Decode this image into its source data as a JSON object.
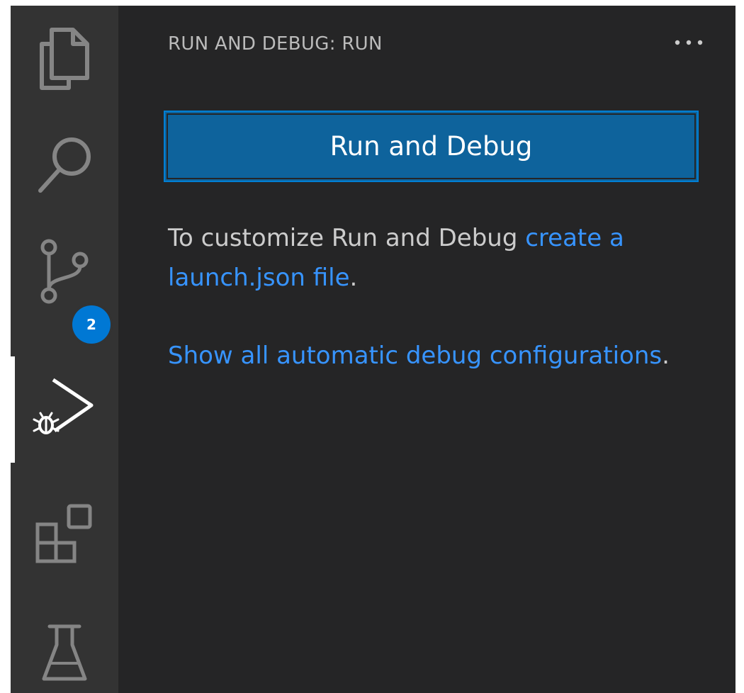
{
  "activity_bar": {
    "items": [
      {
        "name": "explorer",
        "icon": "files-icon"
      },
      {
        "name": "search",
        "icon": "search-icon"
      },
      {
        "name": "source-control",
        "icon": "source-control-icon",
        "badge": "2"
      },
      {
        "name": "run-and-debug",
        "icon": "run-debug-icon",
        "active": true
      },
      {
        "name": "extensions",
        "icon": "extensions-icon"
      },
      {
        "name": "testing",
        "icon": "beaker-icon"
      }
    ],
    "source_control_badge": "2"
  },
  "sidebar": {
    "title": "RUN AND DEBUG: RUN",
    "more_actions_icon": "ellipsis-icon",
    "run_button_label": "Run and Debug",
    "customize_text": "To customize Run and Debug ",
    "create_launch_link": "create a launch.json file",
    "period_1": ".",
    "show_all_link": "Show all automatic debug configurations",
    "period_2": "."
  },
  "colors": {
    "activity_bar_bg": "#333333",
    "sidebar_bg": "#252526",
    "button_bg": "#0e639c",
    "focus_border": "#007fd4",
    "link": "#3794ff",
    "text": "#cccccc",
    "badge_bg": "#0078d4"
  }
}
